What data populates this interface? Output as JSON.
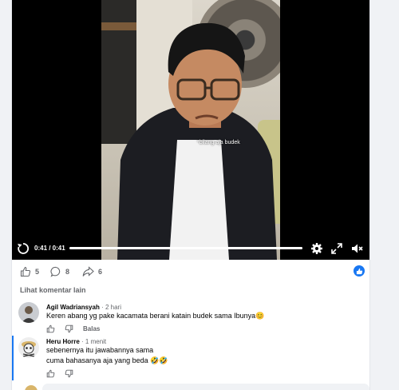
{
  "video": {
    "caption": "*bilang aja budek",
    "current_time": "0:41",
    "duration": "0:41",
    "time_display": "0:41 / 0:41",
    "progress_fraction": 1.0
  },
  "actions": {
    "like_count": "5",
    "comment_count": "8",
    "share_count": "6"
  },
  "comments_section": {
    "view_more_label": "Lihat komentar lain",
    "comments": [
      {
        "author": "Agil Wadriansyah",
        "time": "2 hari",
        "text": "Keren abang yg pake kacamata berani katain budek sama Ibunya😊",
        "reply_label": "Balas"
      },
      {
        "author": "Heru Horre",
        "time": "1 menit",
        "text_line1": "sebenernya itu jawabannya sama",
        "text_line2": "cuma bahasanya aja yang beda 🤣🤣"
      }
    ]
  },
  "colors": {
    "accent": "#1877f2",
    "muted_text": "#65676b",
    "background": "#f0f2f5"
  }
}
